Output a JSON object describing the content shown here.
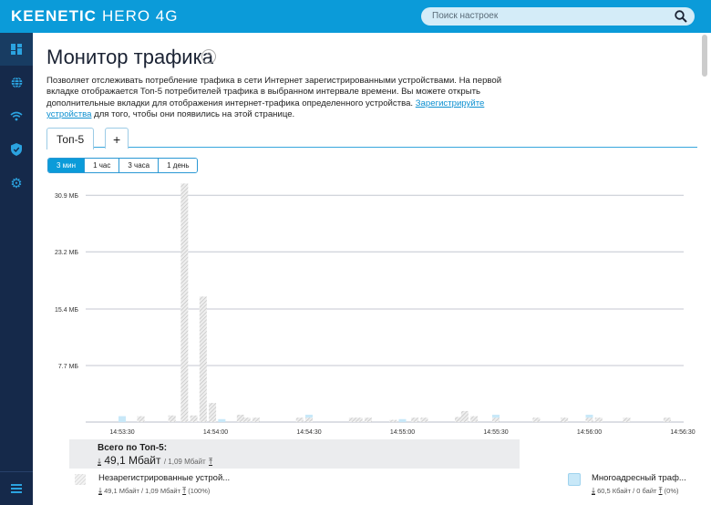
{
  "header": {
    "brand": "KEENETIC",
    "model": "HERO 4G",
    "search_placeholder": "Поиск настроек"
  },
  "sidebar": {
    "items": [
      {
        "icon": "dashboard-icon",
        "active": true
      },
      {
        "icon": "globe-icon"
      },
      {
        "icon": "wifi-icon"
      },
      {
        "icon": "shield-icon"
      },
      {
        "icon": "gear-icon"
      }
    ],
    "bottom_icon": "menu-icon"
  },
  "page": {
    "title": "Монитор трафика",
    "help": "?",
    "desc_1": "Позволяет отслеживать потребление трафика в сети Интернет зарегистрированными устройствами. На первой вкладке отображается Топ-5 потребителей трафика в выбранном интервале времени. Вы можете открыть дополнительные вкладки для отображения интернет-трафика определенного устройства. ",
    "desc_link": "Зарегистрируйте устройства",
    "desc_2": " для того, чтобы они появились на этой странице."
  },
  "tabs": [
    {
      "label": "Топ-5",
      "active": true
    },
    {
      "label": "+"
    }
  ],
  "periods": [
    {
      "label": "3 мин",
      "active": true
    },
    {
      "label": "1 час"
    },
    {
      "label": "3 часа"
    },
    {
      "label": "1 день"
    }
  ],
  "chart_data": {
    "type": "bar",
    "stacked": true,
    "grid": true,
    "y_ticks": [
      "7.7 МБ",
      "15.4 МБ",
      "23.2 МБ",
      "30.9 МБ"
    ],
    "y_tick_values": [
      7.7,
      15.4,
      23.2,
      30.9
    ],
    "ylim": [
      0,
      33
    ],
    "x_ticks": [
      "14:53:30",
      "14:54:00",
      "14:54:30",
      "14:55:00",
      "14:55:30",
      "14:56:00",
      "14:56:30"
    ],
    "series": [
      {
        "name": "Незарегистрированные устрой...",
        "color": "#cccccc",
        "pattern": "hatched",
        "points": [
          [
            "14:53:36",
            0.8
          ],
          [
            "14:53:46",
            0.9
          ],
          [
            "14:53:50",
            32.5
          ],
          [
            "14:53:53",
            0.9
          ],
          [
            "14:53:56",
            17.1
          ],
          [
            "14:53:59",
            2.6
          ],
          [
            "14:54:08",
            1.0
          ],
          [
            "14:54:10",
            0.6
          ],
          [
            "14:54:13",
            0.6
          ],
          [
            "14:54:27",
            0.6
          ],
          [
            "14:54:30",
            0.6
          ],
          [
            "14:54:44",
            0.6
          ],
          [
            "14:54:46",
            0.6
          ],
          [
            "14:54:49",
            0.6
          ],
          [
            "14:54:57",
            0.3
          ],
          [
            "14:55:04",
            0.6
          ],
          [
            "14:55:07",
            0.6
          ],
          [
            "14:55:18",
            0.7
          ],
          [
            "14:55:20",
            1.5
          ],
          [
            "14:55:23",
            0.8
          ],
          [
            "14:55:30",
            0.6
          ],
          [
            "14:55:43",
            0.6
          ],
          [
            "14:55:52",
            0.6
          ],
          [
            "14:56:00",
            0.6
          ],
          [
            "14:56:03",
            0.6
          ],
          [
            "14:56:12",
            0.6
          ],
          [
            "14:56:25",
            0.6
          ]
        ]
      },
      {
        "name": "Многоадресный траф...",
        "color": "#c8e8f8",
        "points": [
          [
            "14:53:30",
            0.8
          ],
          [
            "14:54:02",
            0.4
          ],
          [
            "14:54:30",
            0.4
          ],
          [
            "14:55:00",
            0.4
          ],
          [
            "14:55:30",
            0.4
          ],
          [
            "14:56:00",
            0.4
          ]
        ]
      }
    ]
  },
  "summary": {
    "title": "Всего по Топ-5:",
    "down": "49,1 Мбайт",
    "up": "/ 1,09 Мбайт"
  },
  "legend": [
    {
      "name": "Незарегистрированные устрой...",
      "stats": "49,1 Мбайт / 1,09 Мбайт",
      "pct": "(100%)"
    },
    {
      "name": "Многоадресный траф...",
      "stats": "60,5 Кбайт / 0 байт",
      "pct": "(0%)"
    }
  ]
}
